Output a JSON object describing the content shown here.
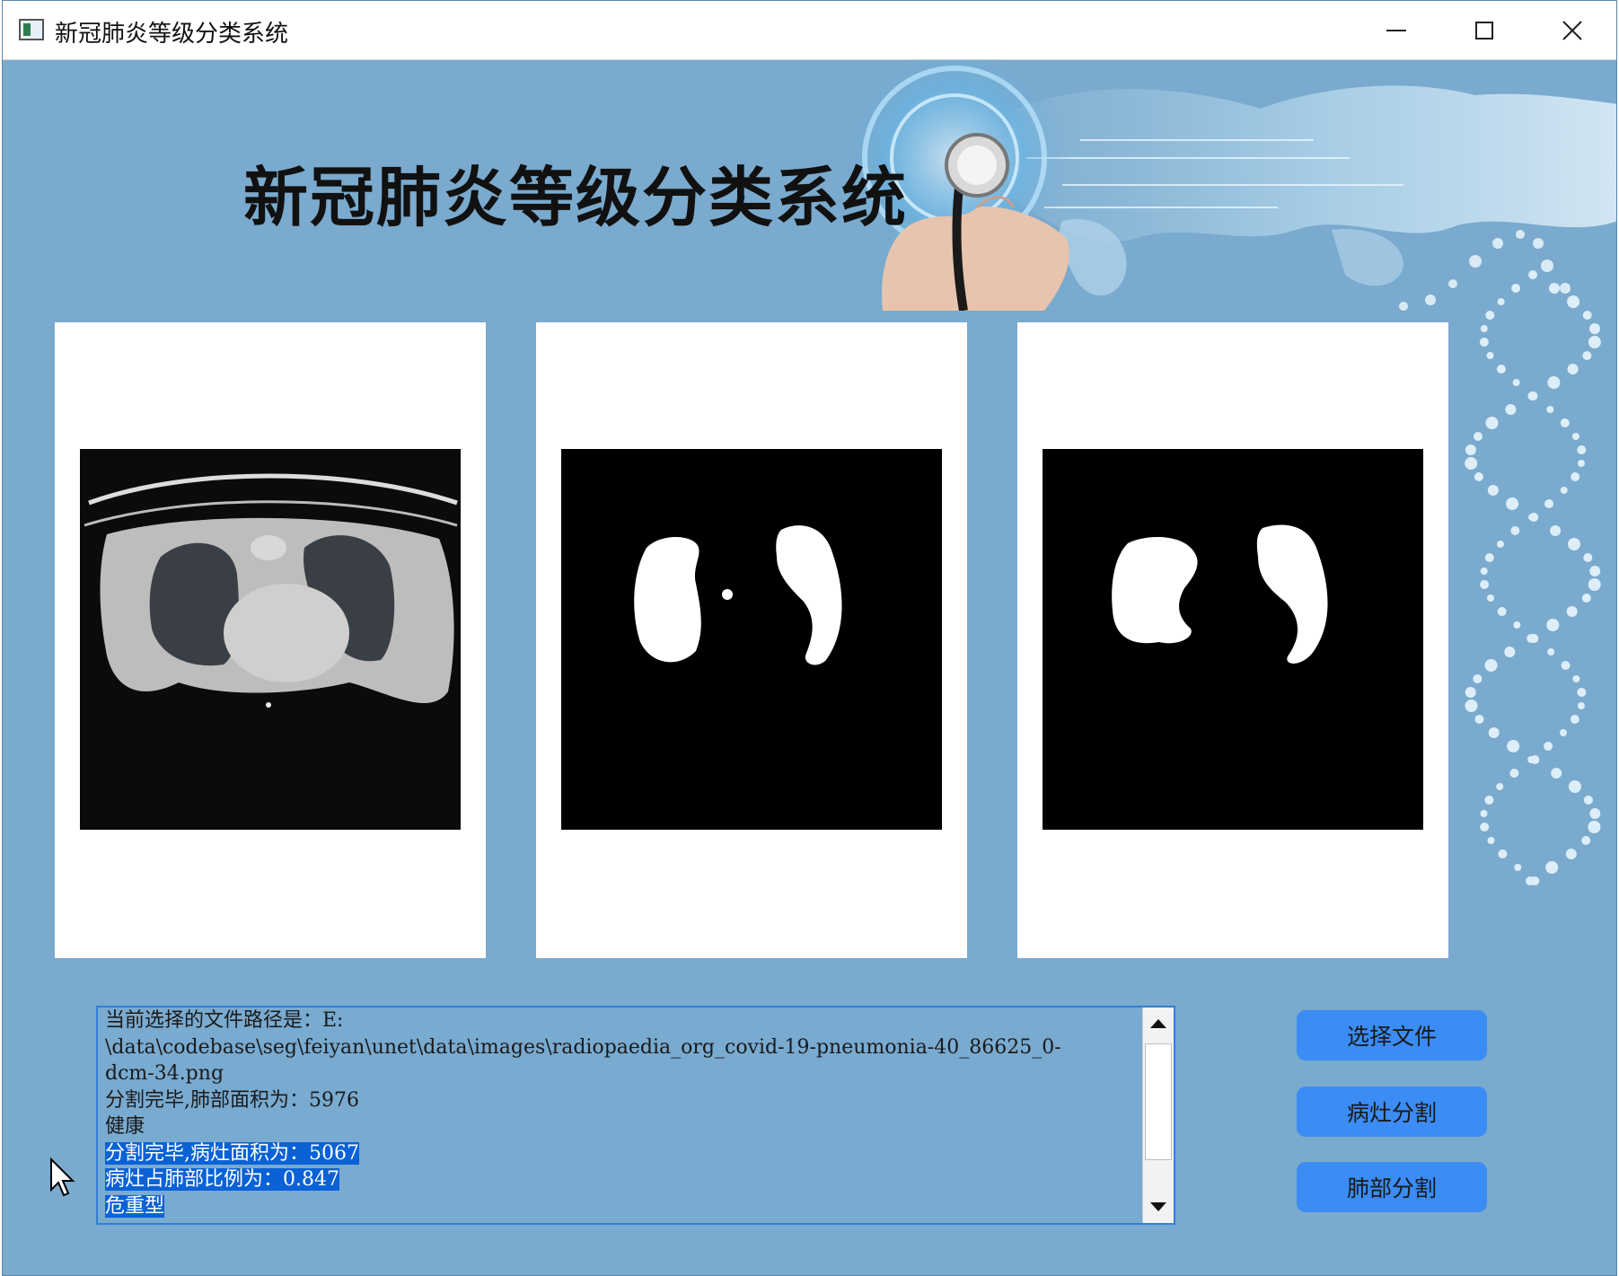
{
  "window": {
    "title": "新冠肺炎等级分类系统",
    "controls": [
      "minimize",
      "maximize",
      "close"
    ]
  },
  "banner": {
    "heading": "新冠肺炎等级分类系统"
  },
  "panels": [
    {
      "name": "original-ct-image"
    },
    {
      "name": "lesion-mask-image"
    },
    {
      "name": "lung-mask-image"
    }
  ],
  "log": {
    "lines": [
      {
        "text": "当前选择的文件路径是：E:",
        "selected": false
      },
      {
        "text": "\\data\\codebase\\seg\\feiyan\\unet\\data\\images\\radiopaedia_org_covid-19-pneumonia-40_86625_0-",
        "selected": false
      },
      {
        "text": "dcm-34.png",
        "selected": false
      },
      {
        "text": "分割完毕,肺部面积为：5976",
        "selected": false
      },
      {
        "text": "健康",
        "selected": false
      },
      {
        "text": "分割完毕,病灶面积为：5067",
        "selected": true
      },
      {
        "text": "病灶占肺部比例为：0.847",
        "selected": true
      },
      {
        "text": "危重型",
        "selected": true
      }
    ]
  },
  "buttons": {
    "select_file": "选择文件",
    "lesion_segment": "病灶分割",
    "lung_segment": "肺部分割"
  },
  "colors": {
    "background": "#7aaacd",
    "button": "#3b8cf5",
    "selection": "#0a62d6"
  },
  "icons": [
    "app-icon",
    "minimize-icon",
    "maximize-icon",
    "close-icon",
    "scroll-up-icon",
    "scroll-down-icon",
    "mouse-cursor-icon"
  ]
}
